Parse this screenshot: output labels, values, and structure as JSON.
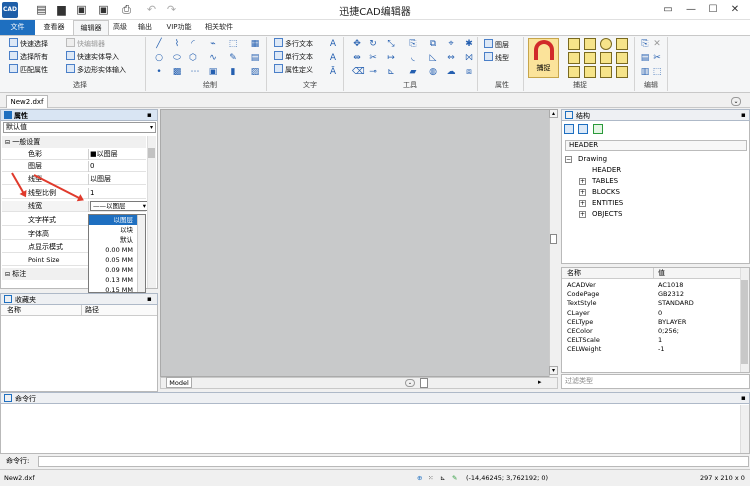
{
  "app": {
    "logo_text": "CAD",
    "title": "迅捷CAD编辑器"
  },
  "ribbon_tabs": [
    "文件",
    "查看器",
    "编辑器",
    "高级",
    "输出",
    "VIP功能",
    "相关软件"
  ],
  "ribbon": {
    "select": {
      "items": [
        "快速选择",
        "选择所有",
        "匹配属性",
        "快编辑器",
        "快速实体导入",
        "多边形实体输入"
      ],
      "label": "选择"
    },
    "draw": {
      "label": "绘制"
    },
    "text": {
      "items": [
        "多行文本",
        "单行文本",
        "属性定义"
      ],
      "label": "文字"
    },
    "tools": {
      "label": "工具"
    },
    "props": {
      "items": [
        "图层",
        "线型"
      ],
      "label": "属性"
    },
    "snap": {
      "button": "捕捉",
      "label": "捕捉"
    },
    "edit": {
      "label": "编辑"
    }
  },
  "doc_tab": "New2.dxf",
  "properties": {
    "title": "属性",
    "dropdown": "默认值",
    "section": "一般设置",
    "rows": [
      {
        "name": "色彩",
        "value": "■以图层"
      },
      {
        "name": "图层",
        "value": "0"
      },
      {
        "name": "线型",
        "value": "以图层"
      },
      {
        "name": "线型比例",
        "value": "1"
      },
      {
        "name": "线宽",
        "value": "——以图层"
      },
      {
        "name": "文字样式",
        "value": ""
      },
      {
        "name": "字体高",
        "value": ""
      },
      {
        "name": "点显示模式",
        "value": ""
      },
      {
        "name": "Point Size",
        "value": ""
      }
    ],
    "section2": "标注",
    "linewidth_options": [
      "以图层",
      "以块",
      "默认",
      "0.00 MM",
      "0.05 MM",
      "0.09 MM",
      "0.13 MM",
      "0.15 MM"
    ]
  },
  "favorites": {
    "title": "收藏夹",
    "col_name": "名称",
    "col_path": "路径"
  },
  "model_tab": "Model",
  "structure": {
    "title": "结构",
    "header_field": "HEADER",
    "tree": [
      "Drawing",
      "HEADER",
      "TABLES",
      "BLOCKS",
      "ENTITIES",
      "OBJECTS"
    ]
  },
  "kv": {
    "col_name": "名称",
    "col_value": "值",
    "rows": [
      {
        "k": "ACADVer",
        "v": "AC1018"
      },
      {
        "k": "CodePage",
        "v": "GB2312"
      },
      {
        "k": "TextStyle",
        "v": "STANDARD"
      },
      {
        "k": "CLayer",
        "v": "0"
      },
      {
        "k": "CELType",
        "v": "BYLAYER"
      },
      {
        "k": "CEColor",
        "v": "0;256;"
      },
      {
        "k": "CELTScale",
        "v": "1"
      },
      {
        "k": "CELWeight",
        "v": "-1"
      }
    ],
    "filter_placeholder": "过滤类型"
  },
  "command": {
    "title": "命令行",
    "prompt": "命令行:"
  },
  "status": {
    "file": "New2.dxf",
    "coords": "(-14,46245; 3,762192; 0)",
    "size": "297 x 210 x 0"
  }
}
